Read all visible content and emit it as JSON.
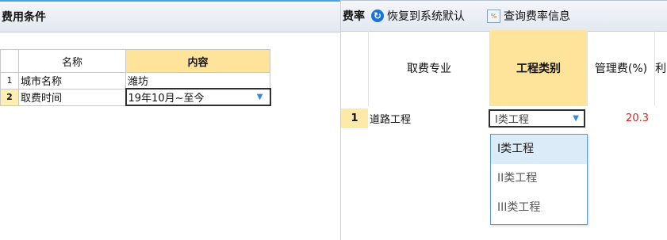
{
  "left": {
    "title": "费用条件",
    "columns": [
      "名称",
      "内容"
    ],
    "rows": [
      {
        "num": "1",
        "name": "城市名称",
        "value": "潍坊"
      },
      {
        "num": "2",
        "name": "取费时间",
        "value": "19年10月~至今"
      }
    ]
  },
  "right": {
    "title": "费率",
    "restore_label": "恢复到系统默认",
    "query_label": "查询费率信息",
    "columns": [
      "取费专业",
      "工程类别",
      "管理费(%)",
      "利"
    ],
    "row": {
      "num": "1",
      "major": "道路工程",
      "category": "I类工程",
      "mgmt_fee": "20.3"
    },
    "dropdown_options": [
      "I类工程",
      "II类工程",
      "III类工程"
    ]
  },
  "colors": {
    "accent": "#1a73d9",
    "header_yellow": "#fde49a",
    "fee_red": "#e02020"
  }
}
